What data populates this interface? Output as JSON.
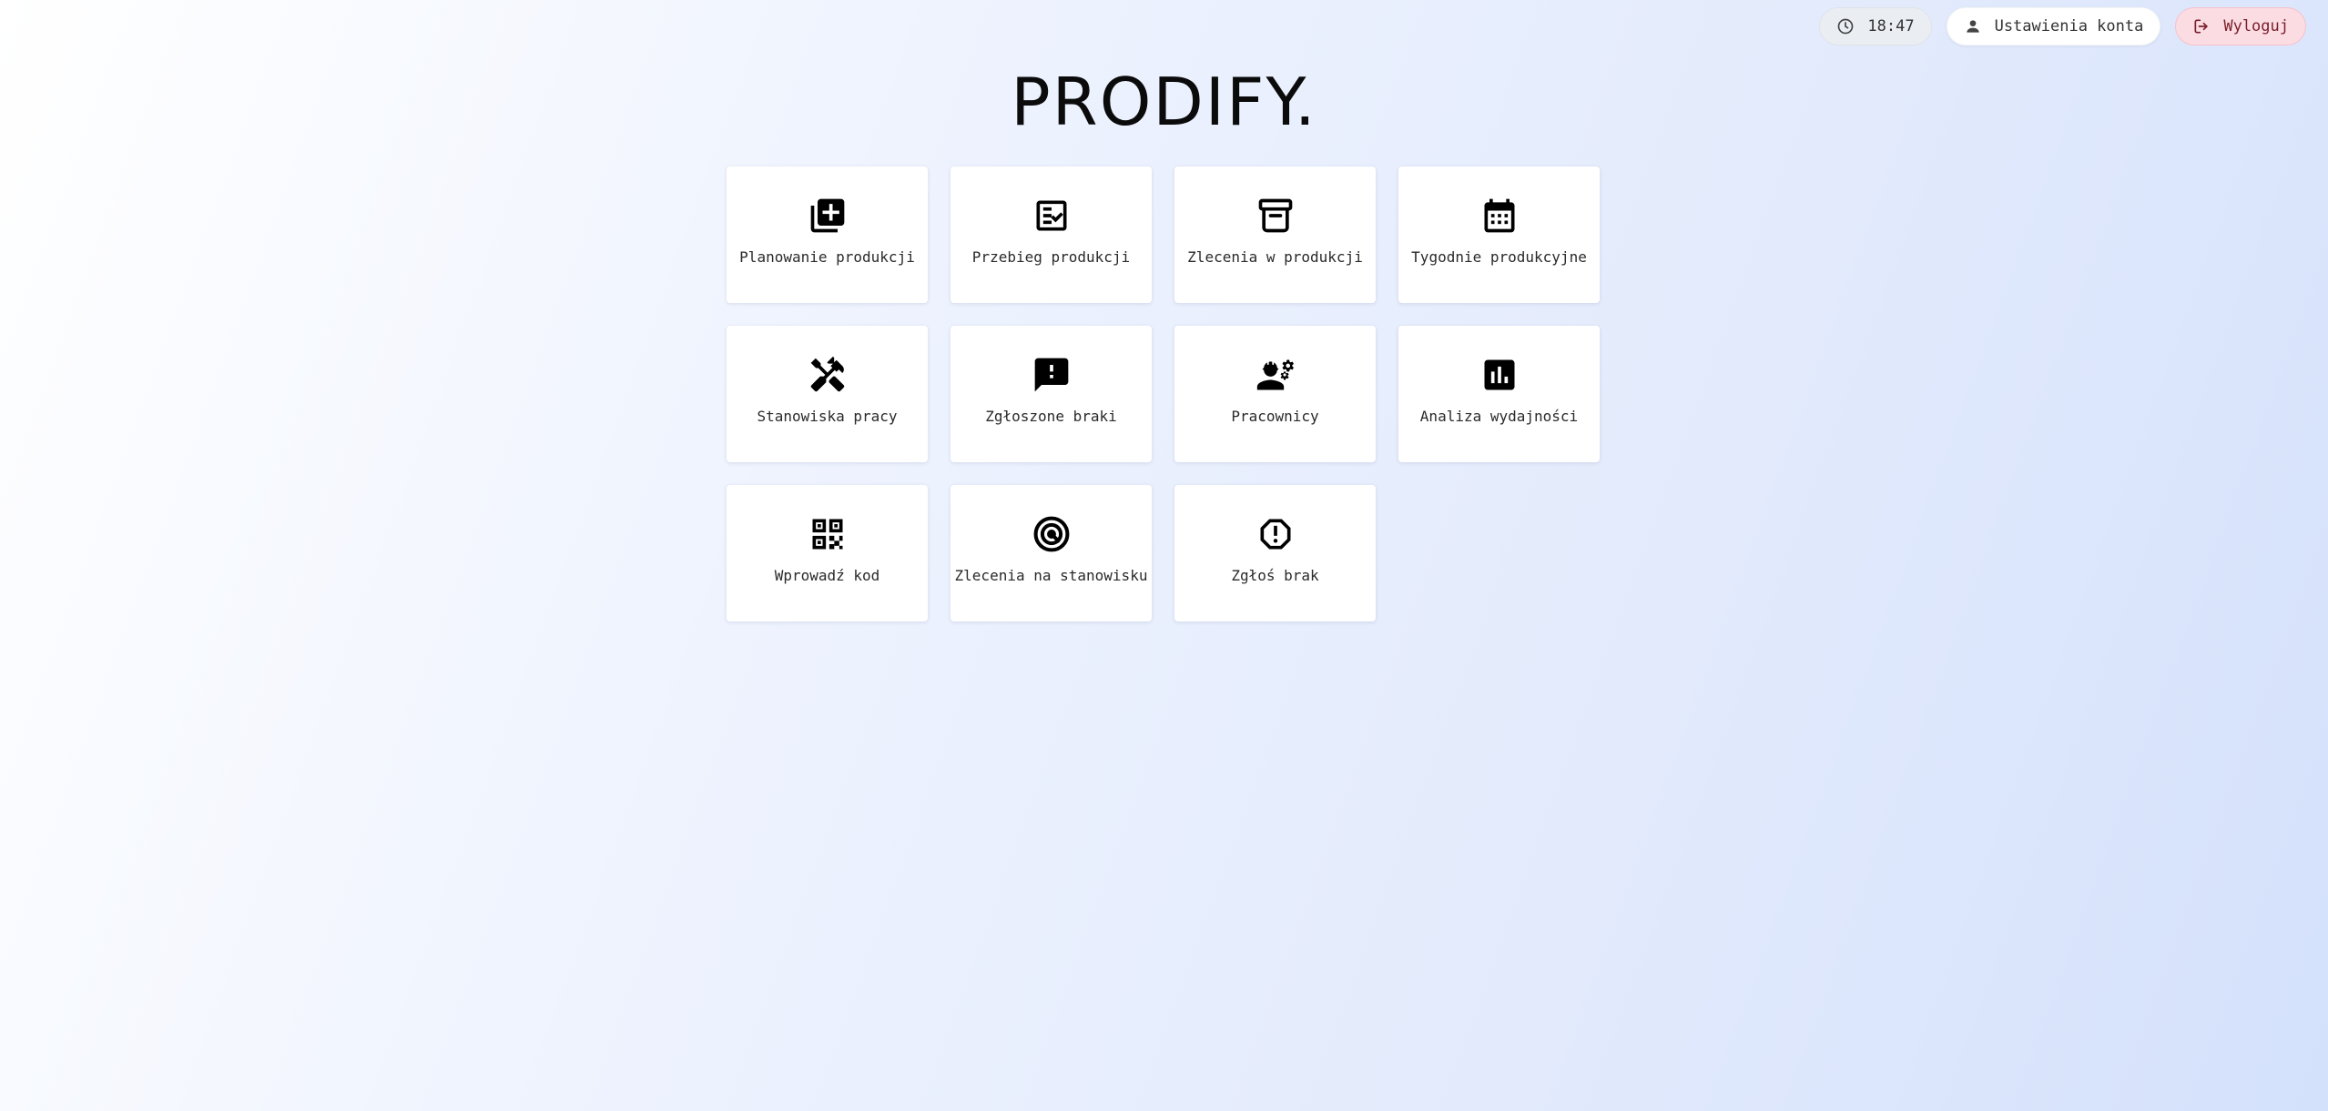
{
  "header": {
    "time": "18:47",
    "account_label": "Ustawienia konta",
    "logout_label": "Wyloguj",
    "icons": {
      "time": "clock-icon",
      "account": "person-icon",
      "logout": "logout-icon"
    },
    "colors": {
      "logout_bg": "#fbdce2",
      "logout_text": "#7a1f2b"
    }
  },
  "brand": {
    "title": "PRODIFY."
  },
  "tiles": [
    {
      "label": "Planowanie produkcji",
      "icon": "add-to-library-icon"
    },
    {
      "label": "Przebieg produkcji",
      "icon": "checklist-icon"
    },
    {
      "label": "Zlecenia w produkcji",
      "icon": "archive-icon"
    },
    {
      "label": "Tygodnie produkcyjne",
      "icon": "calendar-icon"
    },
    {
      "label": "Stanowiska pracy",
      "icon": "tools-icon"
    },
    {
      "label": "Zgłoszone braki",
      "icon": "feedback-icon"
    },
    {
      "label": "Pracownicy",
      "icon": "engineer-icon"
    },
    {
      "label": "Analiza wydajności",
      "icon": "bar-chart-icon"
    },
    {
      "label": "Wprowadź kod",
      "icon": "qr-code-icon"
    },
    {
      "label": "Zlecenia na stanowisku",
      "icon": "target-icon"
    },
    {
      "label": "Zgłoś brak",
      "icon": "report-icon"
    }
  ]
}
